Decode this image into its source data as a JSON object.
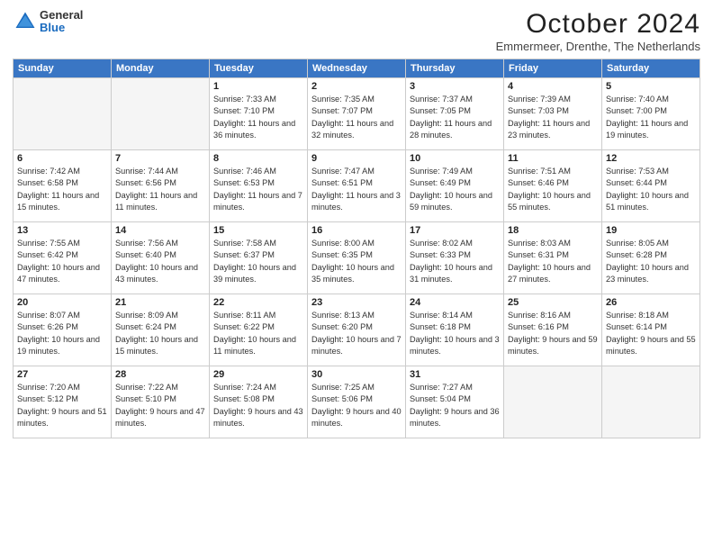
{
  "header": {
    "title": "October 2024",
    "subtitle": "Emmermeer, Drenthe, The Netherlands",
    "logo_general": "General",
    "logo_blue": "Blue"
  },
  "weekdays": [
    "Sunday",
    "Monday",
    "Tuesday",
    "Wednesday",
    "Thursday",
    "Friday",
    "Saturday"
  ],
  "weeks": [
    [
      {
        "day": "",
        "sunrise": "",
        "sunset": "",
        "daylight": "",
        "empty": true
      },
      {
        "day": "",
        "sunrise": "",
        "sunset": "",
        "daylight": "",
        "empty": true
      },
      {
        "day": "1",
        "sunrise": "Sunrise: 7:33 AM",
        "sunset": "Sunset: 7:10 PM",
        "daylight": "Daylight: 11 hours and 36 minutes.",
        "empty": false
      },
      {
        "day": "2",
        "sunrise": "Sunrise: 7:35 AM",
        "sunset": "Sunset: 7:07 PM",
        "daylight": "Daylight: 11 hours and 32 minutes.",
        "empty": false
      },
      {
        "day": "3",
        "sunrise": "Sunrise: 7:37 AM",
        "sunset": "Sunset: 7:05 PM",
        "daylight": "Daylight: 11 hours and 28 minutes.",
        "empty": false
      },
      {
        "day": "4",
        "sunrise": "Sunrise: 7:39 AM",
        "sunset": "Sunset: 7:03 PM",
        "daylight": "Daylight: 11 hours and 23 minutes.",
        "empty": false
      },
      {
        "day": "5",
        "sunrise": "Sunrise: 7:40 AM",
        "sunset": "Sunset: 7:00 PM",
        "daylight": "Daylight: 11 hours and 19 minutes.",
        "empty": false
      }
    ],
    [
      {
        "day": "6",
        "sunrise": "Sunrise: 7:42 AM",
        "sunset": "Sunset: 6:58 PM",
        "daylight": "Daylight: 11 hours and 15 minutes.",
        "empty": false
      },
      {
        "day": "7",
        "sunrise": "Sunrise: 7:44 AM",
        "sunset": "Sunset: 6:56 PM",
        "daylight": "Daylight: 11 hours and 11 minutes.",
        "empty": false
      },
      {
        "day": "8",
        "sunrise": "Sunrise: 7:46 AM",
        "sunset": "Sunset: 6:53 PM",
        "daylight": "Daylight: 11 hours and 7 minutes.",
        "empty": false
      },
      {
        "day": "9",
        "sunrise": "Sunrise: 7:47 AM",
        "sunset": "Sunset: 6:51 PM",
        "daylight": "Daylight: 11 hours and 3 minutes.",
        "empty": false
      },
      {
        "day": "10",
        "sunrise": "Sunrise: 7:49 AM",
        "sunset": "Sunset: 6:49 PM",
        "daylight": "Daylight: 10 hours and 59 minutes.",
        "empty": false
      },
      {
        "day": "11",
        "sunrise": "Sunrise: 7:51 AM",
        "sunset": "Sunset: 6:46 PM",
        "daylight": "Daylight: 10 hours and 55 minutes.",
        "empty": false
      },
      {
        "day": "12",
        "sunrise": "Sunrise: 7:53 AM",
        "sunset": "Sunset: 6:44 PM",
        "daylight": "Daylight: 10 hours and 51 minutes.",
        "empty": false
      }
    ],
    [
      {
        "day": "13",
        "sunrise": "Sunrise: 7:55 AM",
        "sunset": "Sunset: 6:42 PM",
        "daylight": "Daylight: 10 hours and 47 minutes.",
        "empty": false
      },
      {
        "day": "14",
        "sunrise": "Sunrise: 7:56 AM",
        "sunset": "Sunset: 6:40 PM",
        "daylight": "Daylight: 10 hours and 43 minutes.",
        "empty": false
      },
      {
        "day": "15",
        "sunrise": "Sunrise: 7:58 AM",
        "sunset": "Sunset: 6:37 PM",
        "daylight": "Daylight: 10 hours and 39 minutes.",
        "empty": false
      },
      {
        "day": "16",
        "sunrise": "Sunrise: 8:00 AM",
        "sunset": "Sunset: 6:35 PM",
        "daylight": "Daylight: 10 hours and 35 minutes.",
        "empty": false
      },
      {
        "day": "17",
        "sunrise": "Sunrise: 8:02 AM",
        "sunset": "Sunset: 6:33 PM",
        "daylight": "Daylight: 10 hours and 31 minutes.",
        "empty": false
      },
      {
        "day": "18",
        "sunrise": "Sunrise: 8:03 AM",
        "sunset": "Sunset: 6:31 PM",
        "daylight": "Daylight: 10 hours and 27 minutes.",
        "empty": false
      },
      {
        "day": "19",
        "sunrise": "Sunrise: 8:05 AM",
        "sunset": "Sunset: 6:28 PM",
        "daylight": "Daylight: 10 hours and 23 minutes.",
        "empty": false
      }
    ],
    [
      {
        "day": "20",
        "sunrise": "Sunrise: 8:07 AM",
        "sunset": "Sunset: 6:26 PM",
        "daylight": "Daylight: 10 hours and 19 minutes.",
        "empty": false
      },
      {
        "day": "21",
        "sunrise": "Sunrise: 8:09 AM",
        "sunset": "Sunset: 6:24 PM",
        "daylight": "Daylight: 10 hours and 15 minutes.",
        "empty": false
      },
      {
        "day": "22",
        "sunrise": "Sunrise: 8:11 AM",
        "sunset": "Sunset: 6:22 PM",
        "daylight": "Daylight: 10 hours and 11 minutes.",
        "empty": false
      },
      {
        "day": "23",
        "sunrise": "Sunrise: 8:13 AM",
        "sunset": "Sunset: 6:20 PM",
        "daylight": "Daylight: 10 hours and 7 minutes.",
        "empty": false
      },
      {
        "day": "24",
        "sunrise": "Sunrise: 8:14 AM",
        "sunset": "Sunset: 6:18 PM",
        "daylight": "Daylight: 10 hours and 3 minutes.",
        "empty": false
      },
      {
        "day": "25",
        "sunrise": "Sunrise: 8:16 AM",
        "sunset": "Sunset: 6:16 PM",
        "daylight": "Daylight: 9 hours and 59 minutes.",
        "empty": false
      },
      {
        "day": "26",
        "sunrise": "Sunrise: 8:18 AM",
        "sunset": "Sunset: 6:14 PM",
        "daylight": "Daylight: 9 hours and 55 minutes.",
        "empty": false
      }
    ],
    [
      {
        "day": "27",
        "sunrise": "Sunrise: 7:20 AM",
        "sunset": "Sunset: 5:12 PM",
        "daylight": "Daylight: 9 hours and 51 minutes.",
        "empty": false
      },
      {
        "day": "28",
        "sunrise": "Sunrise: 7:22 AM",
        "sunset": "Sunset: 5:10 PM",
        "daylight": "Daylight: 9 hours and 47 minutes.",
        "empty": false
      },
      {
        "day": "29",
        "sunrise": "Sunrise: 7:24 AM",
        "sunset": "Sunset: 5:08 PM",
        "daylight": "Daylight: 9 hours and 43 minutes.",
        "empty": false
      },
      {
        "day": "30",
        "sunrise": "Sunrise: 7:25 AM",
        "sunset": "Sunset: 5:06 PM",
        "daylight": "Daylight: 9 hours and 40 minutes.",
        "empty": false
      },
      {
        "day": "31",
        "sunrise": "Sunrise: 7:27 AM",
        "sunset": "Sunset: 5:04 PM",
        "daylight": "Daylight: 9 hours and 36 minutes.",
        "empty": false
      },
      {
        "day": "",
        "sunrise": "",
        "sunset": "",
        "daylight": "",
        "empty": true
      },
      {
        "day": "",
        "sunrise": "",
        "sunset": "",
        "daylight": "",
        "empty": true
      }
    ]
  ]
}
